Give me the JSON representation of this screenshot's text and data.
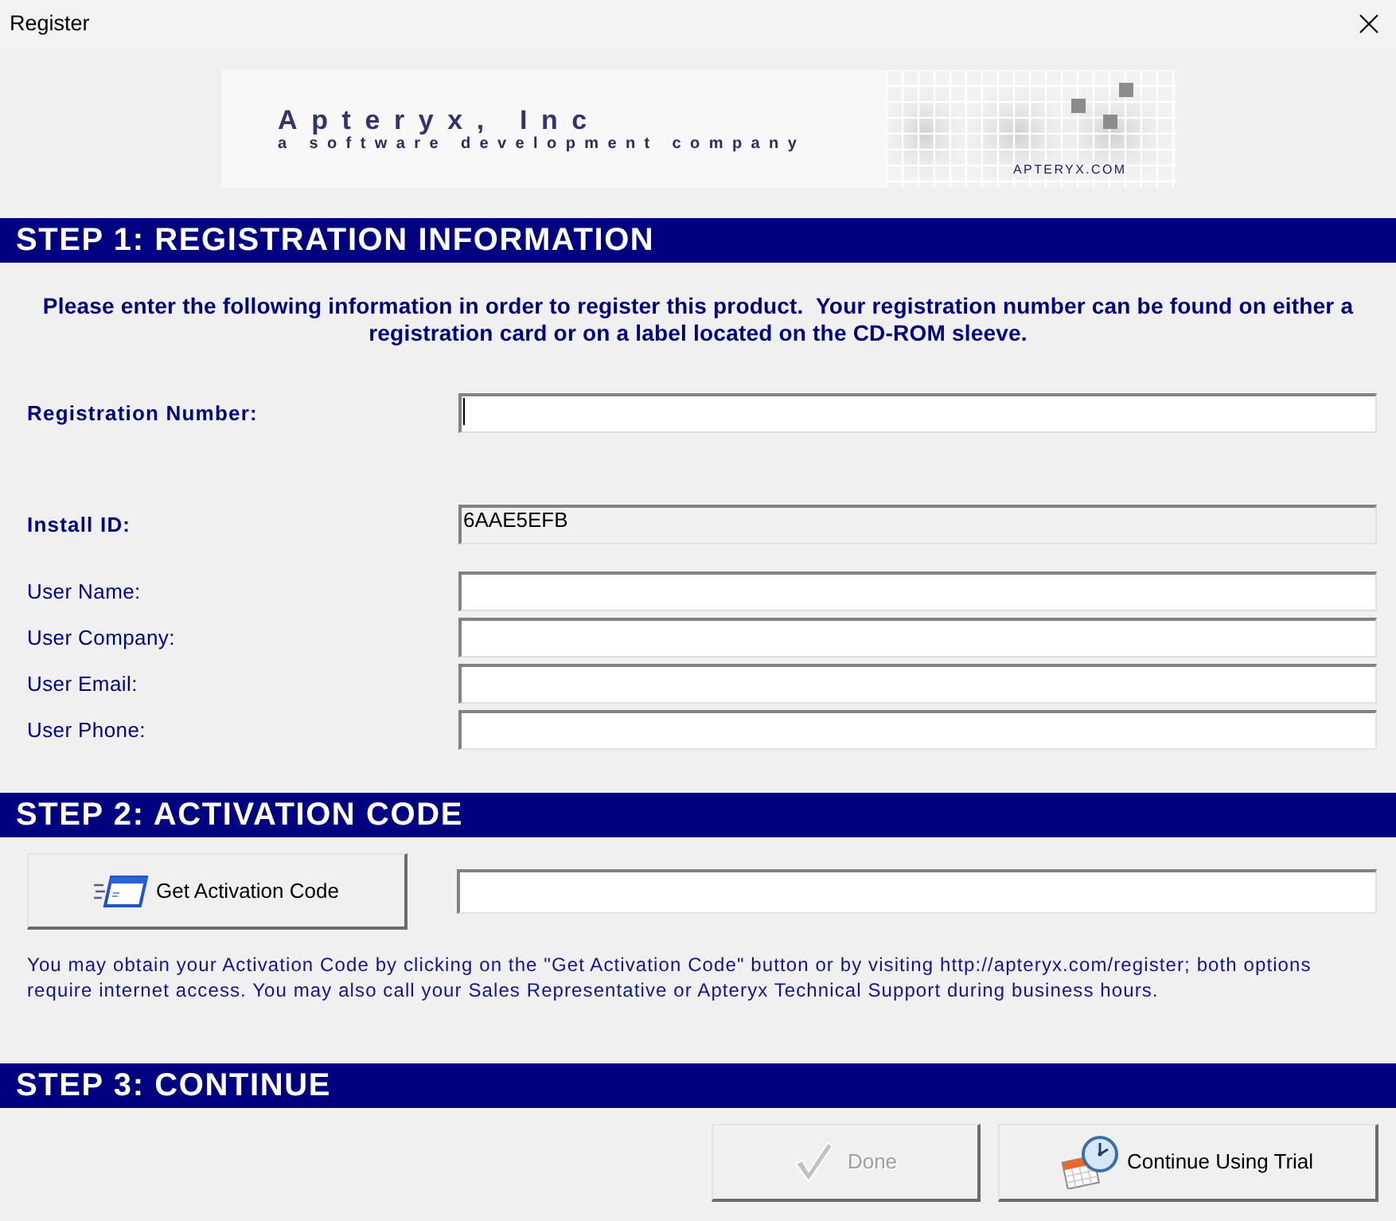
{
  "window": {
    "title": "Register"
  },
  "banner": {
    "company": "Apteryx, Inc",
    "tagline": "a software development company",
    "site": "APTERYX.COM"
  },
  "step1": {
    "header": "STEP 1: REGISTRATION INFORMATION",
    "intro": "Please enter the following information in order to register this product.  Your registration number can be found on either a registration card or on a label located on the CD-ROM sleeve.",
    "fields": [
      {
        "label": "Registration Number:",
        "required": true,
        "readonly": false,
        "focused": true
      },
      {
        "label": "Install ID:",
        "value": "6AAE5EFB",
        "required": true,
        "readonly": true,
        "focused": false
      },
      {
        "label": "User Name:",
        "required": false,
        "readonly": false,
        "focused": false
      },
      {
        "label": "User Company:",
        "required": false,
        "readonly": false,
        "focused": false
      },
      {
        "label": "User Email:",
        "required": false,
        "readonly": false,
        "focused": false
      },
      {
        "label": "User Phone:",
        "required": false,
        "readonly": false,
        "focused": false
      }
    ]
  },
  "step2": {
    "header": "STEP 2: ACTIVATION CODE",
    "button": {
      "label": "Get Activation Code"
    },
    "note": "You may obtain your Activation Code by clicking on the \"Get Activation Code\" button or by visiting http://apteryx.com/register; both options require internet access. You may also call your Sales Representative or Apteryx Technical Support during business hours."
  },
  "step3": {
    "header": "STEP 3: CONTINUE",
    "buttons": [
      {
        "label": "Done",
        "kind": "done",
        "disabled": true
      },
      {
        "label": "Continue Using Trial",
        "kind": "trial",
        "disabled": false
      }
    ]
  }
}
